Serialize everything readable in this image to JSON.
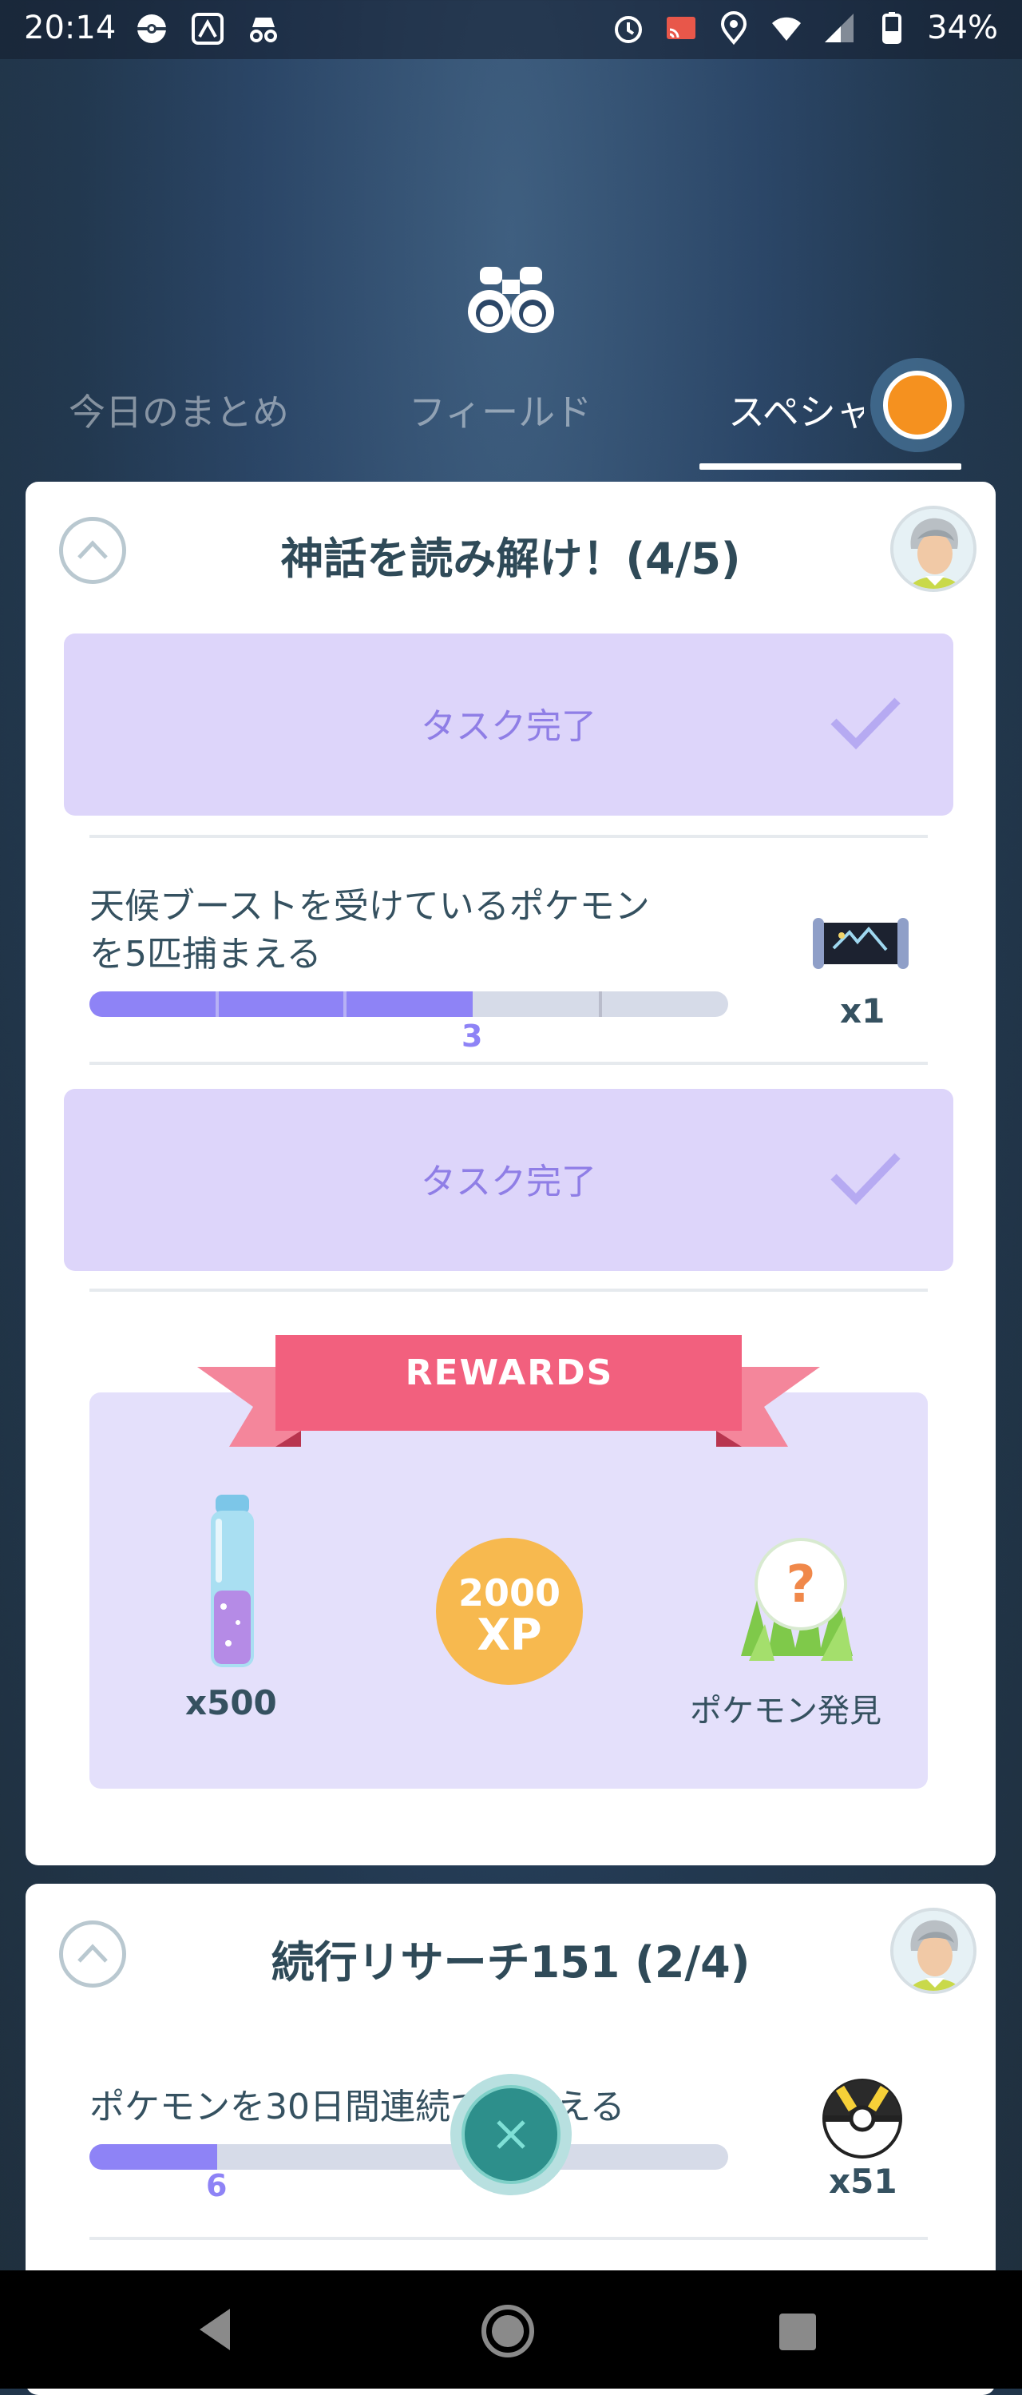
{
  "status_bar": {
    "time": "20:14",
    "battery": "34%",
    "left_icons": [
      "pokeball-icon",
      "app-icon",
      "incognito-icon"
    ],
    "right_icons": [
      "alarm-icon",
      "cast-icon",
      "location-icon",
      "wifi-icon",
      "signal-icon",
      "battery-icon"
    ]
  },
  "tabs": [
    {
      "label": "今日のまとめ",
      "active": false
    },
    {
      "label": "フィールド",
      "active": false
    },
    {
      "label": "スペシャル",
      "active": true
    }
  ],
  "research_1": {
    "title": "神話を読み解け！(4/5)",
    "tasks": [
      {
        "type": "complete",
        "label": "タスク完了"
      },
      {
        "type": "progress",
        "line1": "天候ブーストを受けているポケモン",
        "line2": "を5匹捕まえる",
        "progress_value": "3",
        "progress_current": 3,
        "progress_total": 5,
        "reward_count": "x1",
        "reward_icon": "scroll-icon"
      },
      {
        "type": "complete",
        "label": "タスク完了"
      }
    ],
    "rewards": {
      "banner": "REWARDS",
      "items": [
        {
          "icon": "stardust-icon",
          "label": "x500"
        },
        {
          "icon": "xp-coin-icon",
          "line1": "2000",
          "line2": "XP"
        },
        {
          "icon": "mystery-pokemon-icon",
          "label": "ポケモン発見"
        }
      ]
    }
  },
  "research_2": {
    "title": "続行リサーチ151 (2/4)",
    "task": {
      "text": "ポケモンを30日間連続で捕まえる",
      "progress_value": "6",
      "progress_current": 6,
      "progress_total": 30,
      "reward_count": "x51",
      "reward_icon": "ultra-ball-icon"
    }
  },
  "colors": {
    "accent": "#8e83f6",
    "task_complete_bg": "#ddd5fa",
    "ribbon": "#f2607e",
    "title": "#2f4a58"
  }
}
